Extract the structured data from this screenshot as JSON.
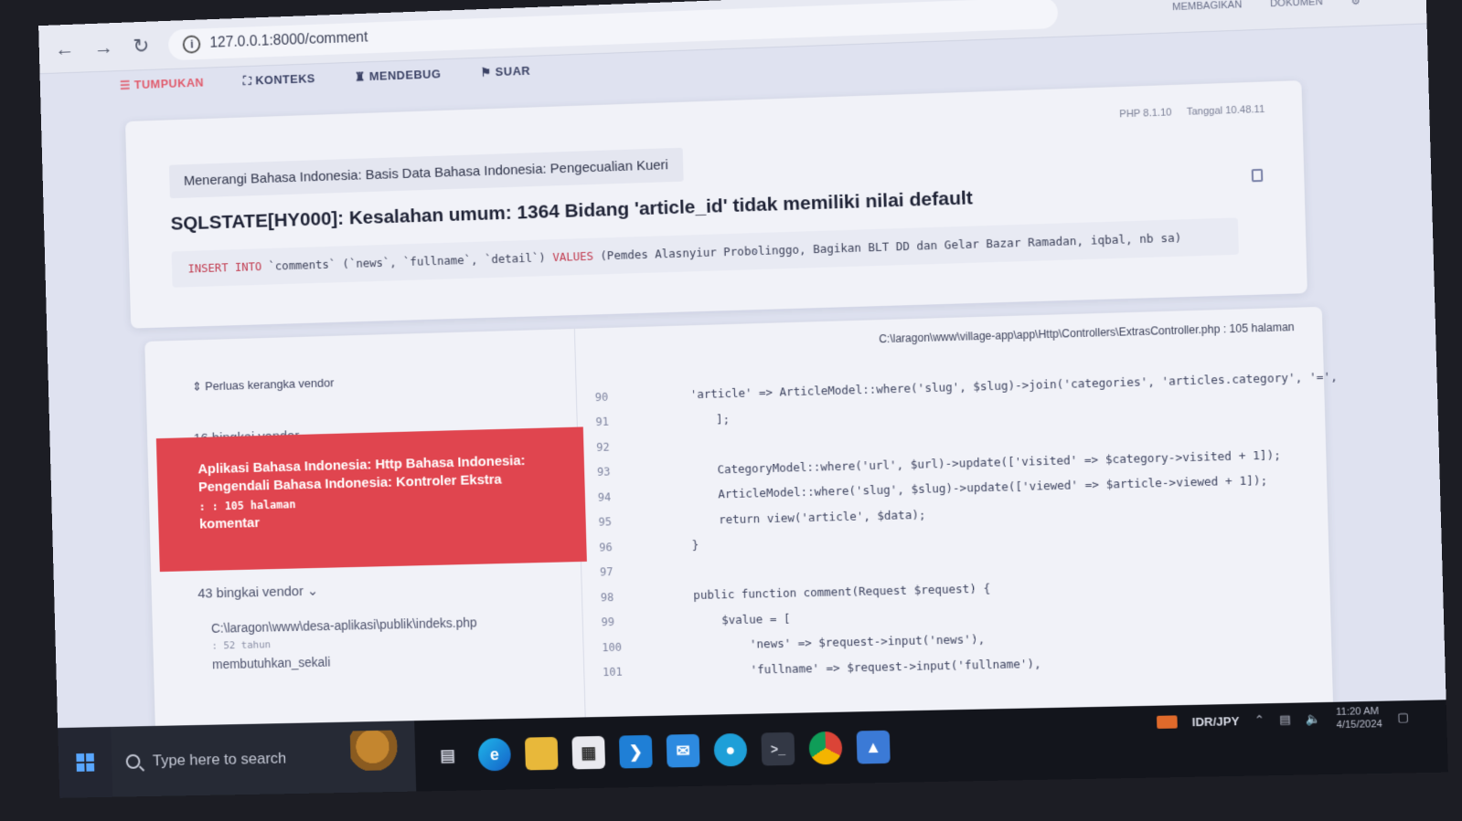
{
  "browser": {
    "url": "127.0.0.1:8000/comment",
    "right_items": [
      "MEMBAGIKAN",
      "DOKUMEN"
    ]
  },
  "tabs": [
    "TUMPUKAN",
    "KONTEKS",
    "MENDEBUG",
    "SUAR"
  ],
  "error": {
    "php_version": "PHP 8.1.10",
    "laravel_version": "Tanggal 10.48.11",
    "exception_class": "Menerangi Bahasa Indonesia: Basis Data Bahasa Indonesia: Pengecualian Kueri",
    "message": "SQLSTATE[HY000]: Kesalahan umum: 1364 Bidang 'article_id' tidak memiliki nilai default",
    "sql_insert": "INSERT INTO",
    "sql_table": " `comments` (`news`, `fullname`, `detail`) ",
    "sql_values_kw": "VALUES",
    "sql_values": " (Pemdes Alasnyiur Probolinggo, Bagikan BLT DD dan Gelar Bazar Ramadan, iqbal, nb sa)"
  },
  "frames": {
    "expand_label": "Perluas kerangka vendor",
    "vendor_group_1": "16 bingkai vendor",
    "active_class": "Aplikasi Bahasa Indonesia: Http Bahasa Indonesia: Pengendali Bahasa Indonesia: Kontroler Ekstra",
    "active_line": ": : 105 halaman",
    "active_function": "komentar",
    "vendor_group_2": "43 bingkai vendor",
    "index_path": "C:\\laragon\\www\\desa-aplikasi\\publik\\indeks.php",
    "index_line": ": 52 tahun",
    "index_function": "membutuhkan_sekali"
  },
  "code_panel": {
    "file_path": "C:\\laragon\\www\\village-app\\app\\Http\\Controllers\\ExtrasController.php : 105 halaman",
    "lines": [
      {
        "num": "90",
        "text": "            'article' => ArticleModel::where('slug', $slug)->join('categories', 'articles.category', '=',"
      },
      {
        "num": "91",
        "text": "        ];"
      },
      {
        "num": "92",
        "text": ""
      },
      {
        "num": "93",
        "text": "        CategoryModel::where('url', $url)->update(['visited' => $category->visited + 1]);"
      },
      {
        "num": "94",
        "text": "        ArticleModel::where('slug', $slug)->update(['viewed' => $article->viewed + 1]);"
      },
      {
        "num": "95",
        "text": "        return view('article', $data);"
      },
      {
        "num": "96",
        "text": "    }"
      },
      {
        "num": "97",
        "text": ""
      },
      {
        "num": "98",
        "text": "    public function comment(Request $request) {"
      },
      {
        "num": "99",
        "text": "        $value = ["
      },
      {
        "num": "100",
        "text": "            'news' => $request->input('news'),"
      },
      {
        "num": "101",
        "text": "            'fullname' => $request->input('fullname'),"
      }
    ]
  },
  "taskbar": {
    "search_placeholder": "Type here to search",
    "currency_pair": "IDR/JPY",
    "time": "11:20 AM",
    "date": "4/15/2024"
  }
}
